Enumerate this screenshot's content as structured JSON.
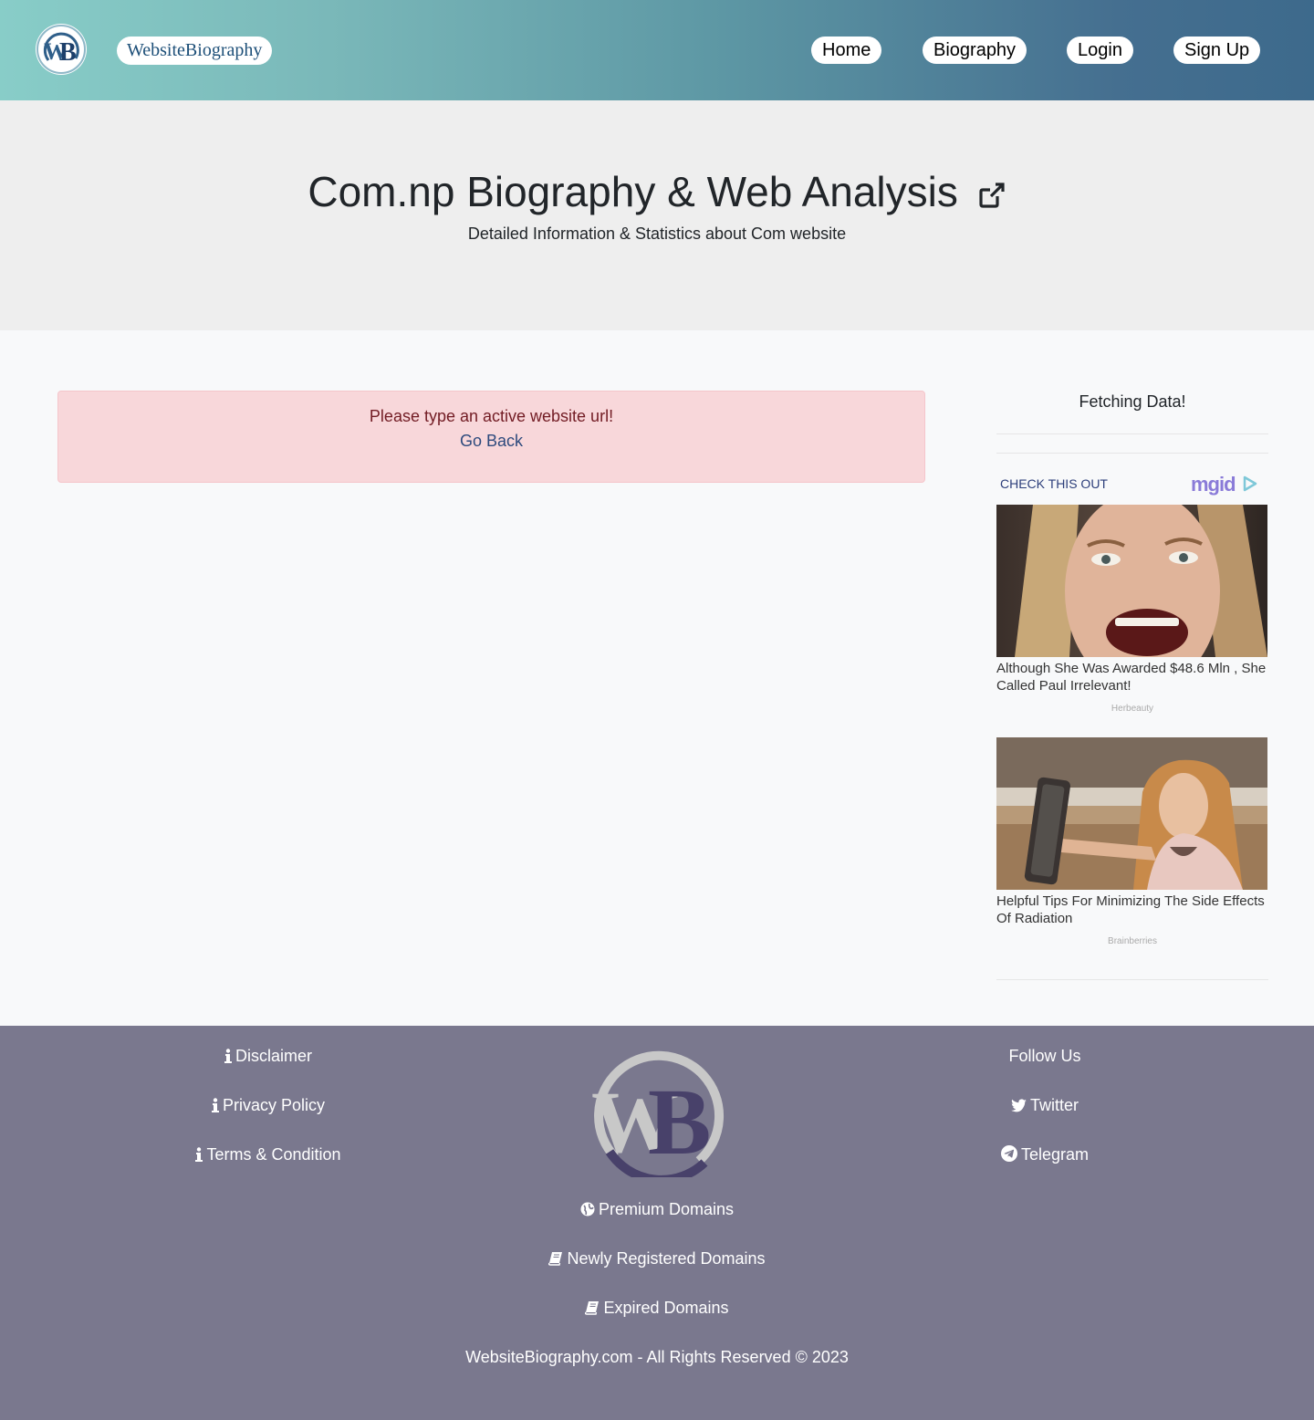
{
  "header": {
    "logo_text": "WB",
    "brand": "WebsiteBiography",
    "nav": [
      "Home",
      "Biography",
      "Login",
      "Sign Up"
    ]
  },
  "hero": {
    "title": "Com.np Biography & Web Analysis",
    "subtitle": "Detailed Information & Statistics about Com website"
  },
  "alert": {
    "message": "Please type an active website url!",
    "link": "Go Back"
  },
  "sidebar": {
    "title": "Fetching Data!",
    "ad_heading": "CHECK THIS OUT",
    "ad_brand": "mgid",
    "ads": [
      {
        "text": "Although She Was Awarded $48.6 Mln , She Called Paul Irrelevant!",
        "source": "Herbeauty"
      },
      {
        "text": "Helpful Tips For Minimizing The Side Effects Of Radiation",
        "source": "Brainberries"
      }
    ]
  },
  "footer": {
    "left": [
      "Disclaimer",
      "Privacy Policy",
      "Terms & Condition"
    ],
    "center": [
      "Premium Domains",
      "Newly Registered Domains",
      "Expired Domains"
    ],
    "follow_title": "Follow Us",
    "social": [
      "Twitter",
      "Telegram"
    ],
    "copyright": "WebsiteBiography.com - All Rights Reserved © 2023"
  },
  "colors": {
    "header_start": "#88cdc8",
    "header_end": "#3d6a8c",
    "alert_bg": "#f8d7da",
    "alert_text": "#721c24",
    "footer_bg": "#7a788e"
  }
}
